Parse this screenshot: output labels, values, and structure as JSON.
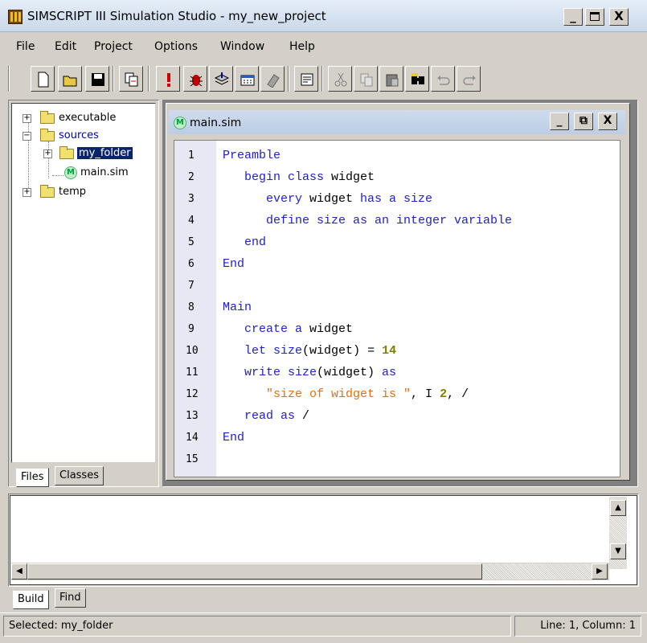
{
  "window": {
    "title": "SIMSCRIPT III Simulation Studio - my_new_project",
    "min": "_",
    "max": "□",
    "close": "X"
  },
  "menu": [
    "File",
    "Edit",
    "Project",
    "Options",
    "Window",
    "Help"
  ],
  "tree": {
    "executable": "executable",
    "sources": "sources",
    "my_folder": "my_folder",
    "main_sim": "main.sim",
    "temp": "temp",
    "m_icon": "M"
  },
  "left_tabs": [
    "Files",
    "Classes"
  ],
  "editor": {
    "title": "main.sim",
    "icon": "M",
    "min": "_",
    "restore": "⧉",
    "close": "X",
    "line_numbers": [
      "1",
      "2",
      "3",
      "4",
      "5",
      "6",
      "7",
      "8",
      "9",
      "10",
      "11",
      "12",
      "13",
      "14",
      "15"
    ],
    "lines": {
      "l1": "Preamble",
      "l2a": "   begin class ",
      "l2b": "widget",
      "l3a": "      every ",
      "l3b": "widget",
      "l3c": " has a size",
      "l4": "      define size as an integer variable",
      "l5": "   end",
      "l6": "End",
      "l8": "Main",
      "l9a": "   create a ",
      "l9b": "widget",
      "l10a": "   let size",
      "l10b": "(",
      "l10c": "widget",
      "l10d": ") = ",
      "l10e": "14",
      "l11a": "   write size",
      "l11b": "(widget)",
      "l11c": " as",
      "l12a": "      ",
      "l12b": "\"size of widget is \"",
      "l12c": ", I ",
      "l12d": "2",
      "l12e": ", /",
      "l13a": "   read as ",
      "l13b": "/",
      "l14": "End"
    }
  },
  "bottom_tabs": [
    "Build",
    "Find"
  ],
  "status": {
    "left": "Selected: my_folder",
    "right": "Line: 1, Column: 1"
  }
}
